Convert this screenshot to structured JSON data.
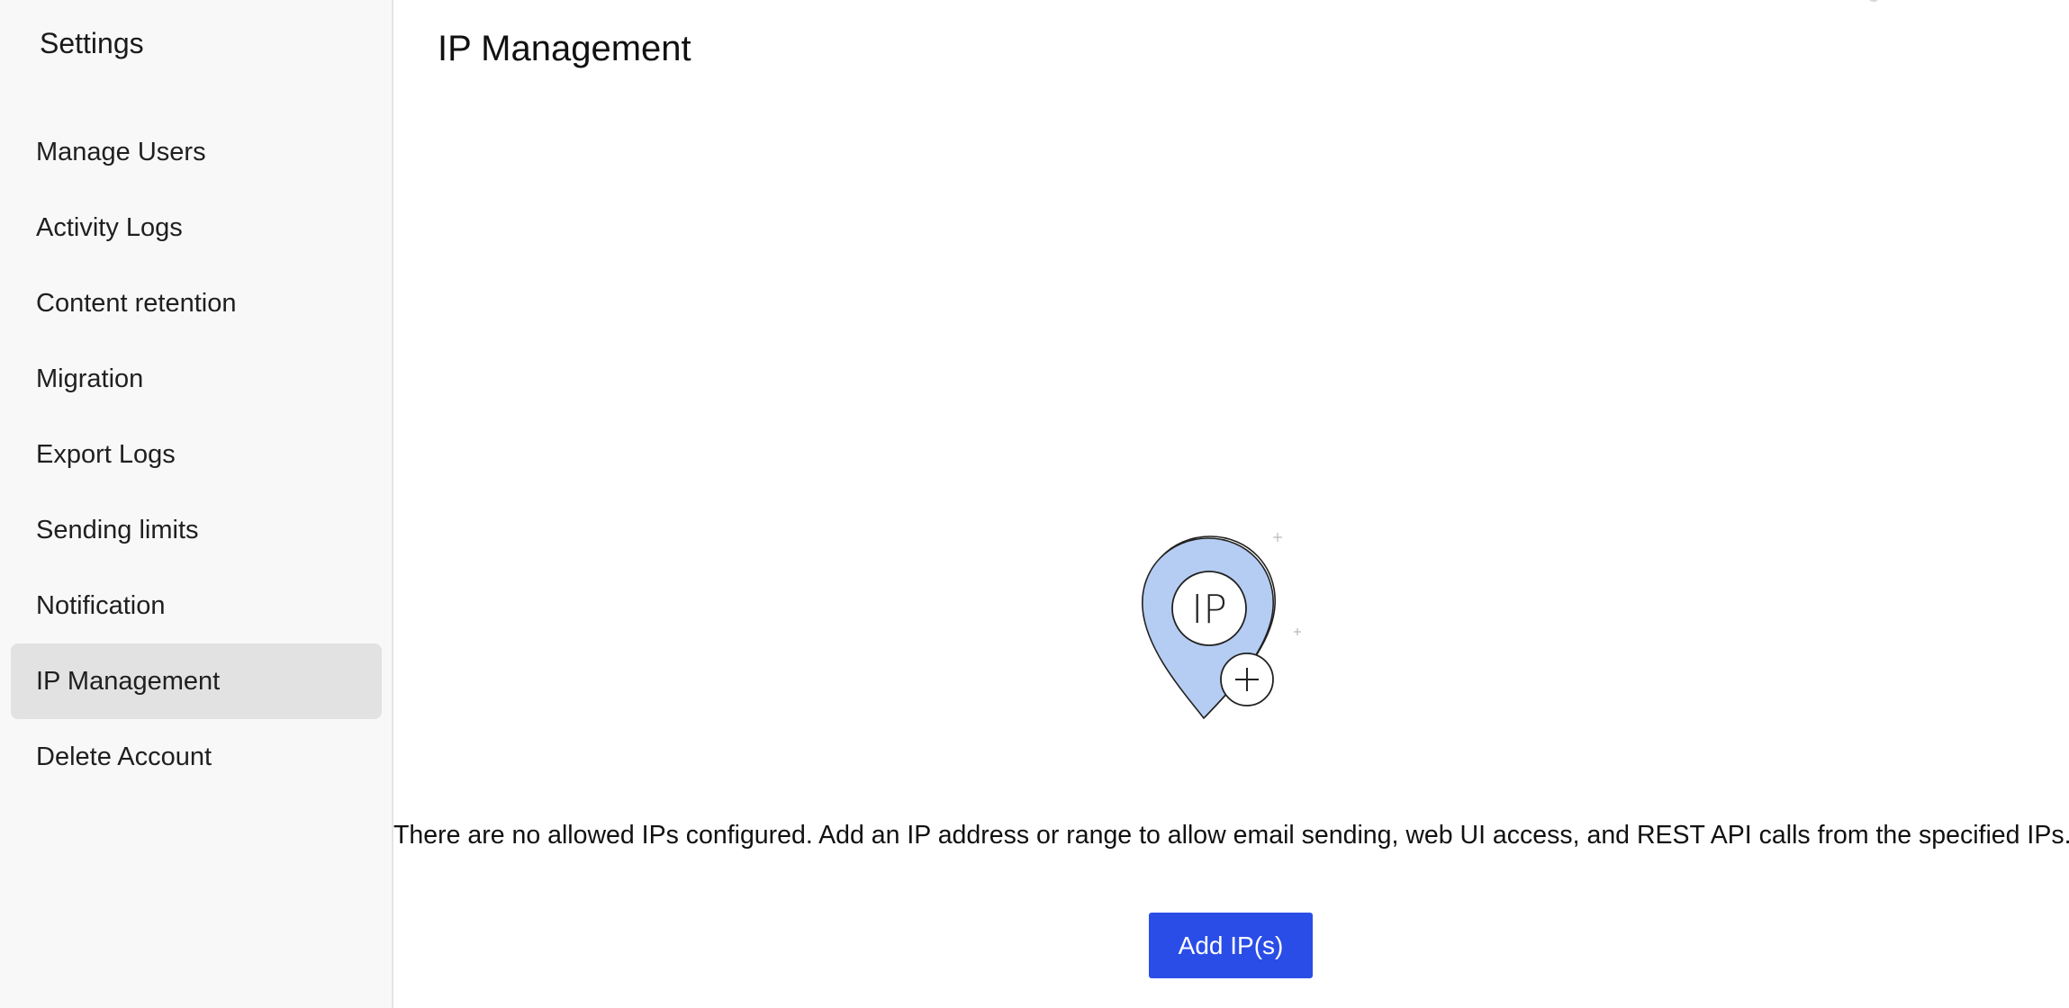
{
  "sidebar": {
    "title": "Settings",
    "items": [
      {
        "label": "Manage Users"
      },
      {
        "label": "Activity Logs"
      },
      {
        "label": "Content retention"
      },
      {
        "label": "Migration"
      },
      {
        "label": "Export Logs"
      },
      {
        "label": "Sending limits"
      },
      {
        "label": "Notification"
      },
      {
        "label": "IP Management",
        "active": true
      },
      {
        "label": "Delete Account"
      }
    ]
  },
  "main": {
    "title": "IP Management",
    "illustration": {
      "icon": "ip-location-pin-plus-icon",
      "badge_text": "IP",
      "fill_color": "#b5cdf2",
      "stroke_color": "#222222"
    },
    "empty_message": "There are no allowed IPs configured. Add an IP address or range to allow email sending, web UI access, and REST API calls from the specified IPs.",
    "add_button_label": "Add IP(s)"
  },
  "colors": {
    "accent": "#2a4de8",
    "sidebar_bg": "#f8f8f8",
    "active_item_bg": "#e2e2e2"
  }
}
